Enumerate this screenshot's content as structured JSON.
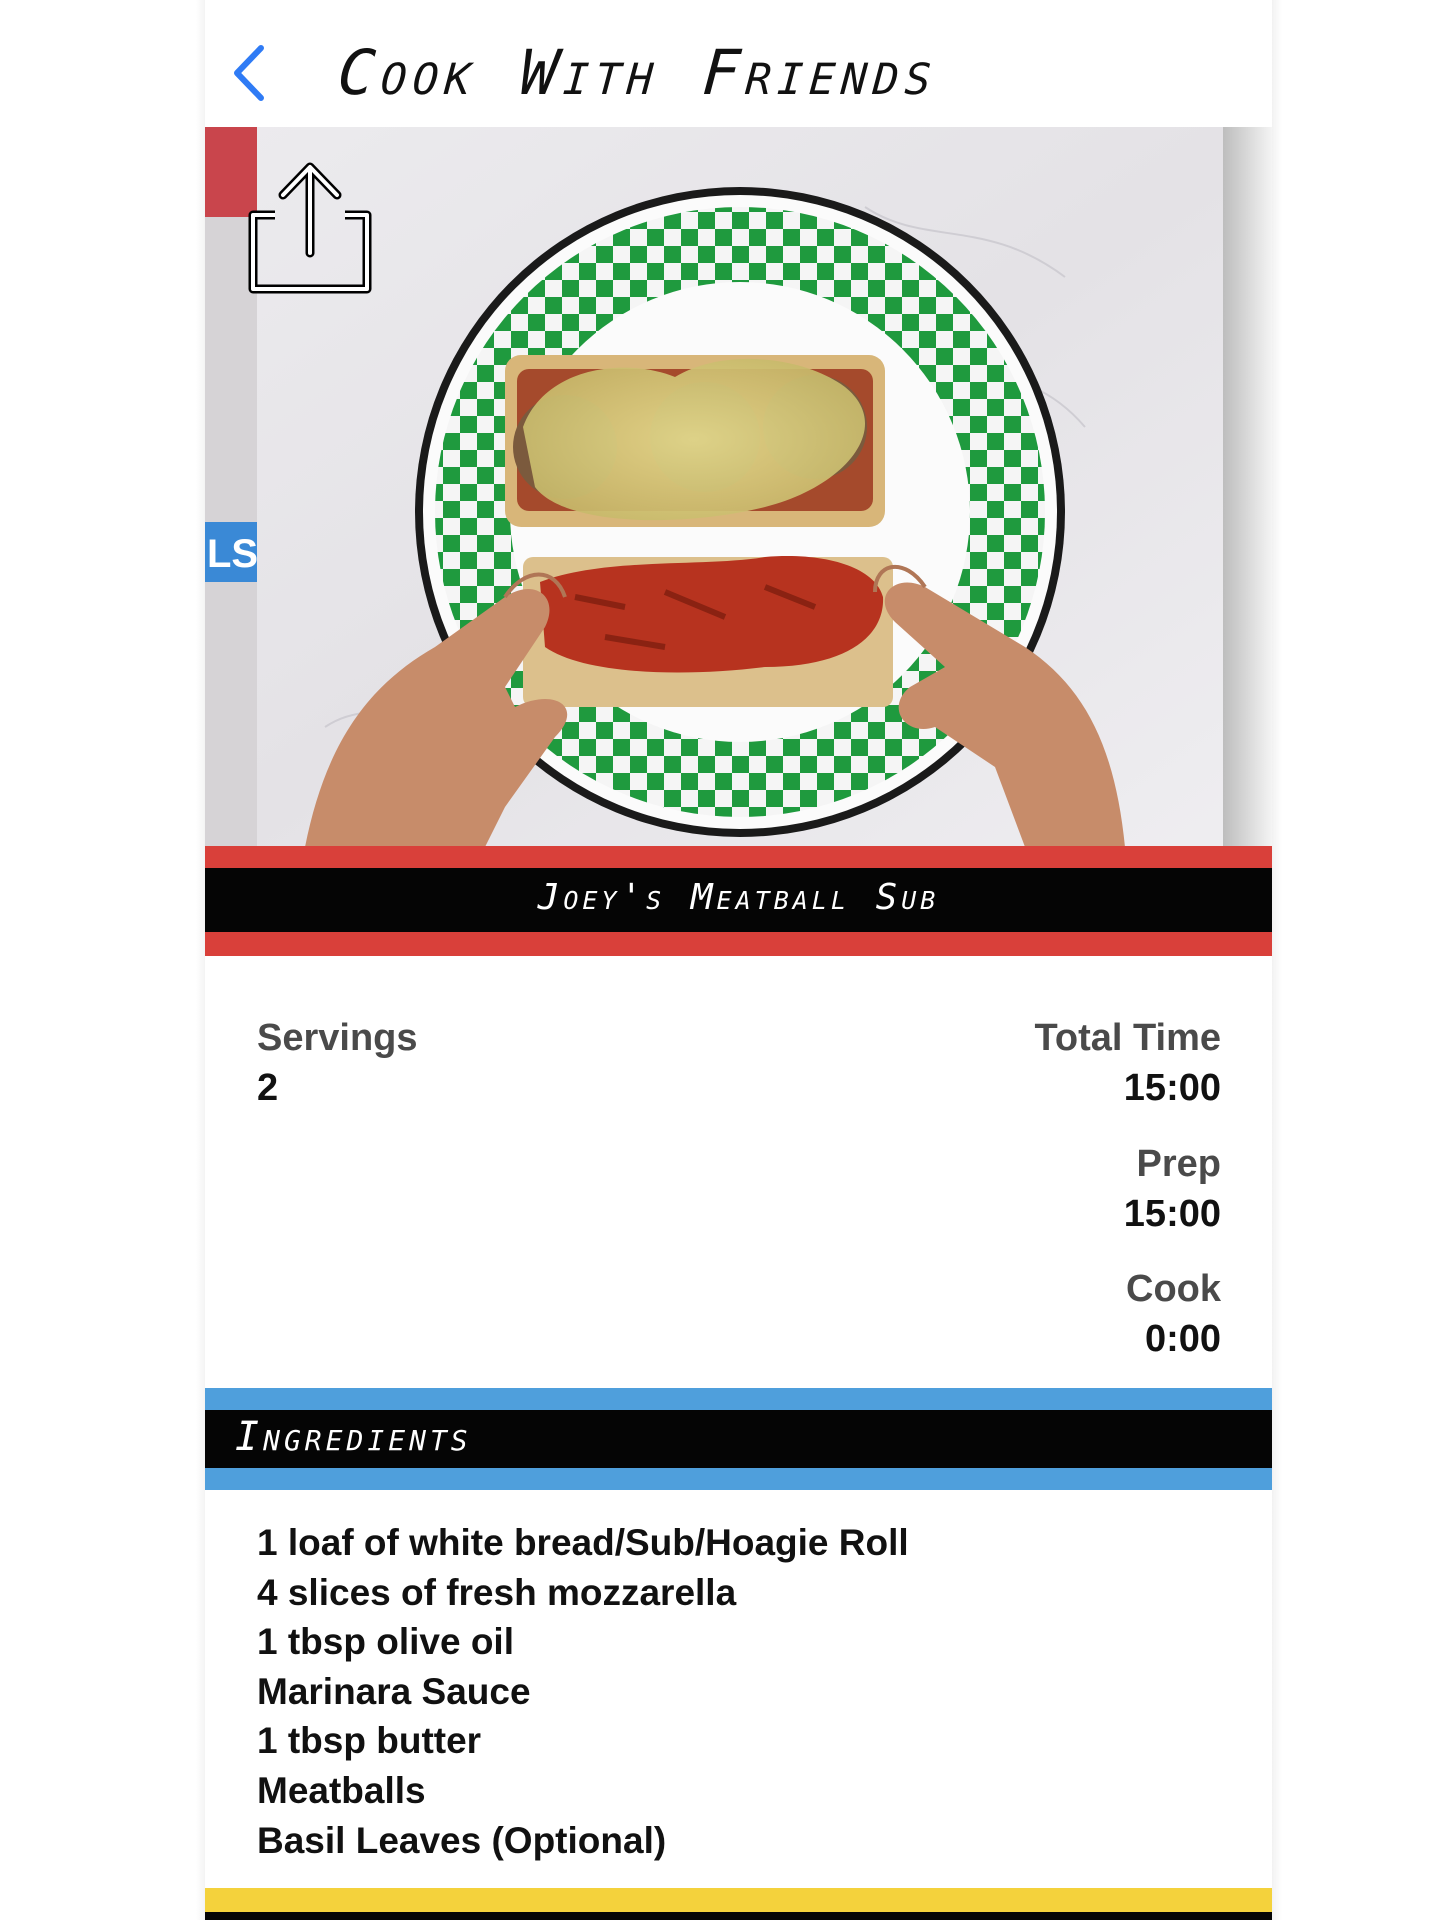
{
  "header": {
    "title": "Cook With Friends",
    "back_icon": "chevron-left-icon"
  },
  "hero": {
    "share_icon": "share-icon",
    "side_label": "LS"
  },
  "recipe": {
    "title": "Joey's Meatball Sub"
  },
  "stats": {
    "servings_label": "Servings",
    "servings_value": "2",
    "total_time_label": "Total Time",
    "total_time_value": "15:00",
    "prep_label": "Prep",
    "prep_value": "15:00",
    "cook_label": "Cook",
    "cook_value": "0:00"
  },
  "ingredients": {
    "title": "Ingredients",
    "items": [
      "1 loaf of white bread/Sub/Hoagie Roll",
      "4 slices of fresh mozzarella",
      "1 tbsp olive oil",
      "Marinara Sauce",
      "1 tbsp butter",
      "Meatballs",
      "Basil Leaves (Optional)"
    ]
  },
  "colors": {
    "accent_blue": "#2f7bf5",
    "title_stripe_red": "#d9403a",
    "ingredients_stripe_blue": "#4f9fdc",
    "bottom_stripe_yellow": "#f4d23c",
    "band_black": "#050505",
    "plate_green": "#1f9a3e"
  }
}
